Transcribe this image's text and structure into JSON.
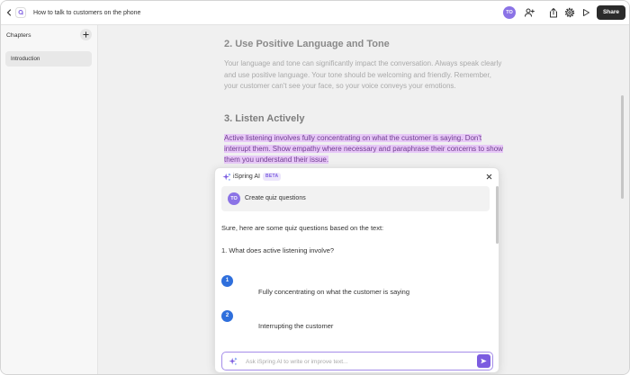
{
  "app": {
    "title": "How to talk to customers on the phone"
  },
  "topbar": {
    "back_icon": "chevron-left-icon",
    "logo_icon": "app-logo-icon",
    "avatar_initials": "TO",
    "add_user_icon": "add-user-icon",
    "export_icon": "export-icon",
    "settings_icon": "gear-icon",
    "preview_icon": "play-icon",
    "share_label": "Share"
  },
  "sidebar": {
    "title": "Chapters",
    "add_icon": "plus-icon",
    "items": [
      {
        "label": "Introduction",
        "selected": true
      }
    ]
  },
  "content": {
    "sections": [
      {
        "heading": "2. Use Positive Language and Tone",
        "paragraph": "Your language and tone can significantly impact the conversation. Always speak clearly and use positive language. Your tone should be welcoming and friendly. Remember, your customer can't see your face, so your voice conveys your emotions."
      },
      {
        "heading": "3. Listen Actively",
        "paragraph": "Active listening involves fully concentrating on what the customer is saying. Don't interrupt them. Show empathy where necessary and paraphrase their concerns to show them you understand their issue.",
        "highlighted": true
      }
    ]
  },
  "ai_panel": {
    "icon": "sparkle-icon",
    "title": "iSpring AI",
    "badge": "BETA",
    "close_icon": "close-icon",
    "prompt": {
      "avatar_initials": "TO",
      "text": "Create quiz questions"
    },
    "response_intro": "Sure, here are some quiz questions based on the text:",
    "question": "1. What does active listening involve?",
    "options": [
      {
        "number": "1",
        "text": "Fully concentrating on what the customer is saying"
      },
      {
        "number": "2",
        "text": "Interrupting the customer"
      }
    ],
    "input_placeholder": "Ask iSpring AI to write or improve text...",
    "send_icon": "send-icon"
  },
  "colors": {
    "accent": "#7c5ce0",
    "share_button": "#2b2b2b",
    "highlight": "#e7c8f7",
    "highlight_text": "#6f3d8f",
    "option_badge": "#2f6fdc",
    "avatar": "#8b73e6",
    "main_bg": "#f0f0f0",
    "sidebar_bg": "#f7f7f7"
  }
}
